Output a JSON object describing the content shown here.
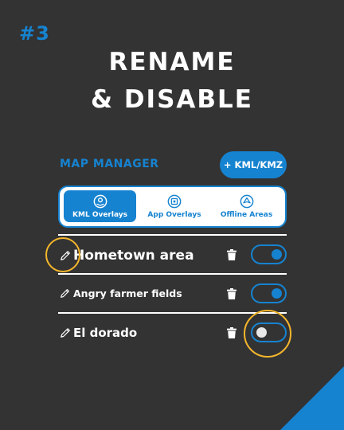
{
  "step_label": "#3",
  "headline": {
    "line1": "RENAME",
    "line2": "& DISABLE"
  },
  "map_manager": {
    "title": "MAP MANAGER",
    "add_button": "+ KML/KMZ",
    "tabs": [
      {
        "label": "KML Overlays",
        "icon": "kml-overlay-icon",
        "selected": true
      },
      {
        "label": "App Overlays",
        "icon": "app-overlay-icon",
        "selected": false
      },
      {
        "label": "Offline Areas",
        "icon": "offline-area-icon",
        "selected": false
      }
    ],
    "overlays": [
      {
        "name": "Hometown area",
        "enabled": true
      },
      {
        "name": "Angry farmer fields",
        "enabled": true
      },
      {
        "name": "El dorado",
        "enabled": false
      }
    ]
  },
  "colors": {
    "background": "#333333",
    "accent": "#1683d0",
    "highlight": "#f5b62c",
    "text": "#ffffff"
  }
}
